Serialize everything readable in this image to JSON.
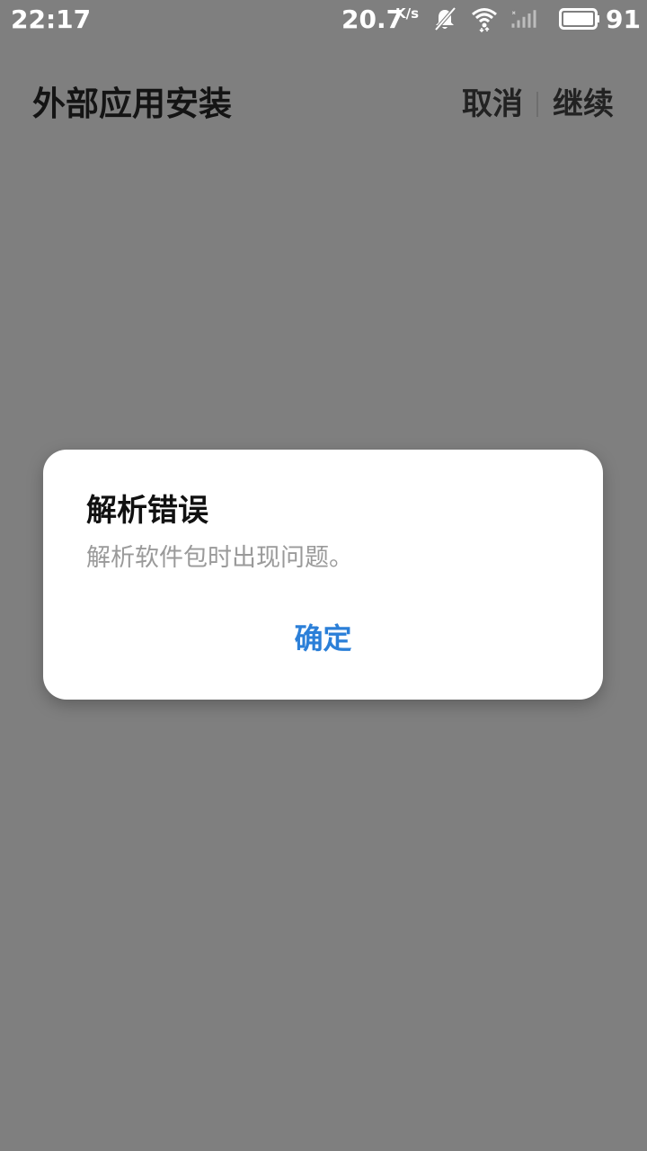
{
  "status_bar": {
    "time": "22:17",
    "network_speed": "20.7",
    "network_speed_unit": "K/s",
    "battery_level": "91",
    "icons": [
      "mute-icon",
      "wifi-icon",
      "signal-icon",
      "battery-icon"
    ]
  },
  "header": {
    "title": "外部应用安装",
    "cancel_label": "取消",
    "continue_label": "继续"
  },
  "dialog": {
    "title": "解析错误",
    "message": "解析软件包时出现问题。",
    "confirm_label": "确定"
  },
  "colors": {
    "overlay_background": "#7f7f7f",
    "dialog_background": "#ffffff",
    "accent": "#2b7fd8",
    "message_text": "#9a9a9a"
  }
}
